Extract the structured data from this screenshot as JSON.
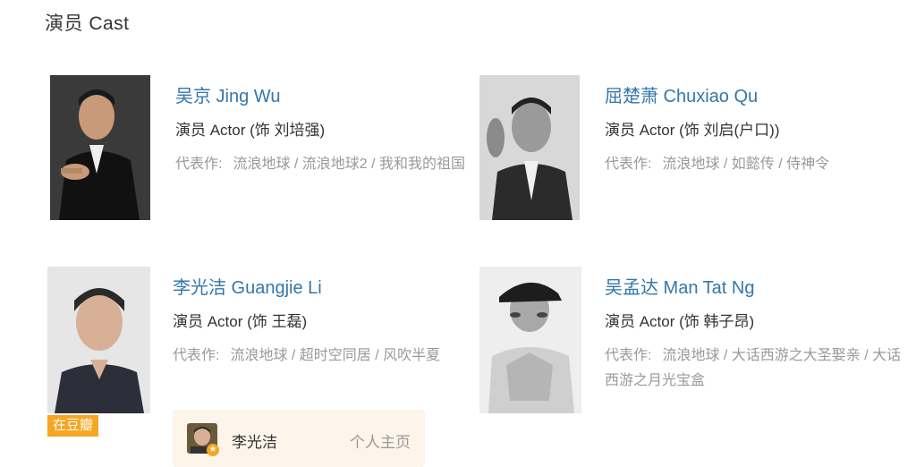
{
  "section": {
    "title": "演员 Cast"
  },
  "cast": [
    {
      "name": "吴京 Jing Wu",
      "role": "演员 Actor (饰 刘培强)",
      "works_label": "代表作:",
      "works": "流浪地球 / 流浪地球2 / 我和我的祖国"
    },
    {
      "name": "屈楚萧 Chuxiao Qu",
      "role": "演员 Actor (饰 刘启(户口))",
      "works_label": "代表作:",
      "works": "流浪地球 / 如懿传 / 侍神令"
    },
    {
      "name": "李光洁 Guangjie Li",
      "role": "演员 Actor (饰 王磊)",
      "works_label": "代表作:",
      "works": "流浪地球 / 超时空同居 / 风吹半夏",
      "badge": "在豆瓣"
    },
    {
      "name": "吴孟达 Man Tat Ng",
      "role": "演员 Actor (饰 韩子昂)",
      "works_label": "代表作:",
      "works": "流浪地球 / 大话西游之大圣娶亲 / 大话西游之月光宝盒"
    }
  ],
  "profile": {
    "name": "李光洁",
    "link": "个人主页"
  }
}
